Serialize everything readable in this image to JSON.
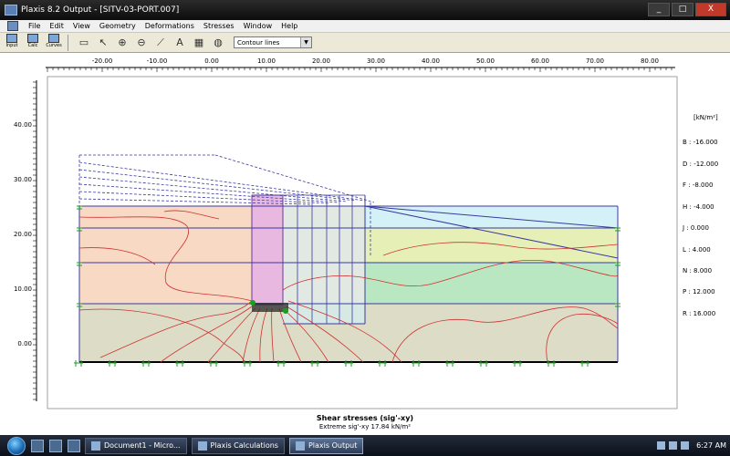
{
  "window": {
    "title": "Plaxis 8.2 Output - [SITV-03-PORT.007]",
    "buttons": [
      "_",
      "□",
      "X"
    ]
  },
  "menu": [
    "File",
    "Edit",
    "View",
    "Geometry",
    "Deformations",
    "Stresses",
    "Window",
    "Help"
  ],
  "toolbar": {
    "input_label": "Input",
    "calc_label": "Calc",
    "curves_label": "Curves",
    "view_select_value": "Contour lines"
  },
  "x_ruler": [
    "-20.00",
    "-10.00",
    "0.00",
    "10.00",
    "20.00",
    "30.00",
    "40.00",
    "50.00",
    "60.00",
    "70.00",
    "80.00"
  ],
  "y_ruler": [
    "40.00",
    "30.00",
    "20.00",
    "10.00",
    "0.00"
  ],
  "legend": {
    "unit": "[kN/m²]",
    "items": [
      "B : -16.000",
      "D : -12.000",
      "F : -8.000",
      "H : -4.000",
      "J : 0.000",
      "L : 4.000",
      "N : 8.000",
      "P : 12.000",
      "R : 16.000"
    ]
  },
  "caption": {
    "title": "Shear stresses (sig'-xy)",
    "extreme": "Extreme sig'-xy 17.84 kN/m²"
  },
  "taskbar": {
    "items": [
      "Document1 - Micro...",
      "Plaxis Calculations",
      "Plaxis Output"
    ],
    "time": "6:27 AM"
  },
  "colors": {
    "layer1": "#f7d9c4",
    "layer2": "#e6f0b6",
    "layer3": "#b9e7c2",
    "layer4": "#dcdcc7",
    "water_zone": "#d3f1f7",
    "wall_zone": "#e8b8e0",
    "contour": "#d03030",
    "mesh": "#3a3aa0",
    "node": "#18a018"
  }
}
